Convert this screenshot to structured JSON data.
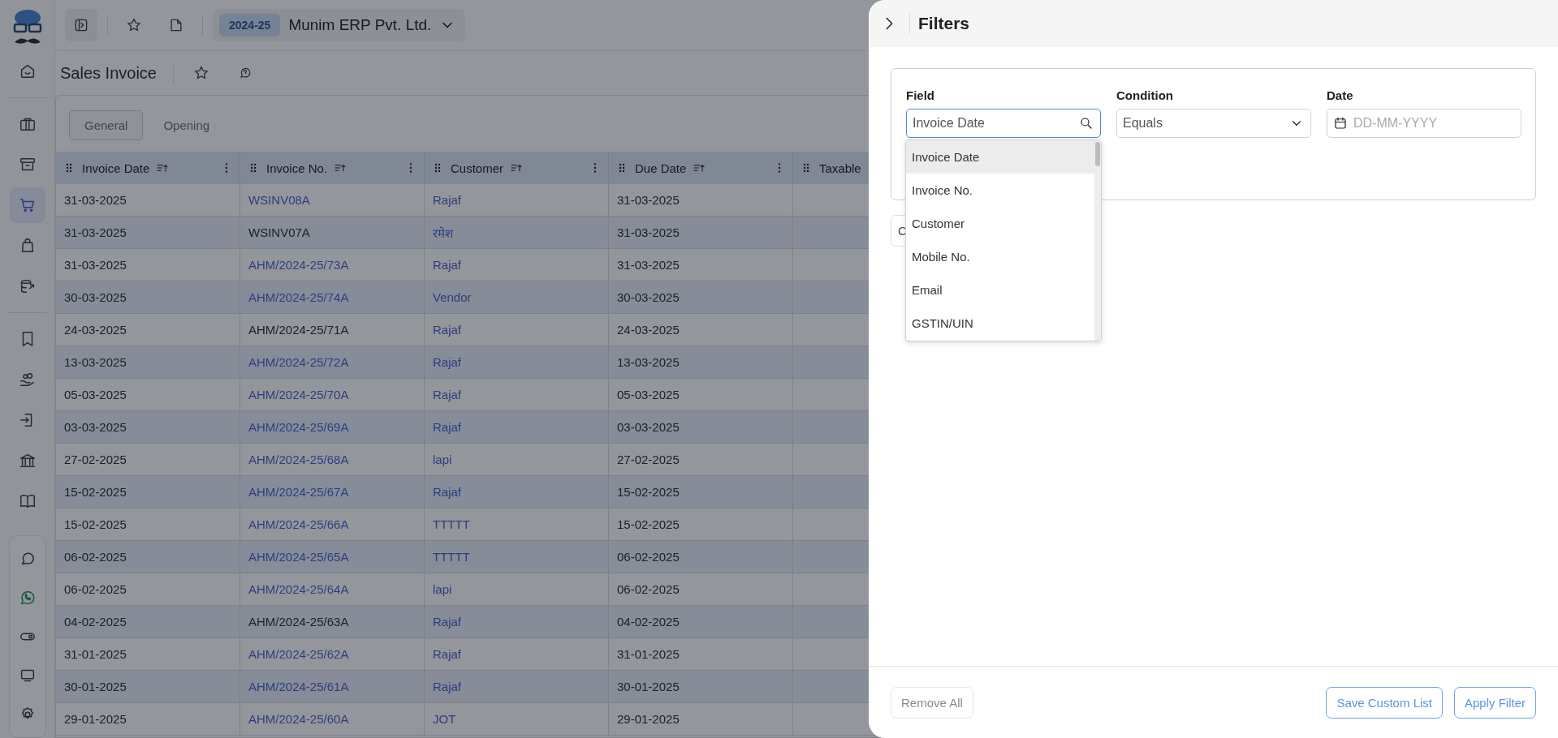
{
  "sidebar": {
    "items": [
      {
        "kind": "home",
        "selected": false
      },
      {
        "kind": "briefcase",
        "selected": false
      },
      {
        "kind": "archive",
        "selected": false
      },
      {
        "kind": "cart",
        "selected": true
      },
      {
        "kind": "bag",
        "selected": false
      },
      {
        "kind": "database",
        "selected": false
      },
      {
        "kind": "receipt",
        "selected": false
      },
      {
        "kind": "coins",
        "selected": false
      },
      {
        "kind": "login",
        "selected": false
      },
      {
        "kind": "bank",
        "selected": false
      },
      {
        "kind": "book",
        "selected": false
      }
    ],
    "bottom_items": [
      {
        "kind": "chat"
      },
      {
        "kind": "whatsapp"
      },
      {
        "kind": "toggle"
      },
      {
        "kind": "monitor"
      },
      {
        "kind": "gear"
      }
    ]
  },
  "top_bar": {
    "year": "2024-25",
    "company": "Munim ERP Pvt. Ltd."
  },
  "page": {
    "title": "Sales Invoice"
  },
  "tabs": [
    {
      "label": "General",
      "selected": true
    },
    {
      "label": "Opening",
      "selected": false
    }
  ],
  "table": {
    "columns": [
      "Invoice Date",
      "Invoice No.",
      "Customer",
      "Due Date",
      "Taxable"
    ],
    "rows": [
      {
        "cells": [
          {
            "text": "31-03-2025",
            "link": false
          },
          {
            "text": "WSINV08A",
            "link": true
          },
          {
            "text": "Rajaf",
            "link": true
          },
          {
            "text": "31-03-2025",
            "link": false
          }
        ]
      },
      {
        "cells": [
          {
            "text": "31-03-2025",
            "link": false
          },
          {
            "text": "WSINV07A",
            "link": false
          },
          {
            "text": "रमेश",
            "link": true
          },
          {
            "text": "31-03-2025",
            "link": false
          }
        ]
      },
      {
        "cells": [
          {
            "text": "31-03-2025",
            "link": false
          },
          {
            "text": "AHM/2024-25/73A",
            "link": true
          },
          {
            "text": "Rajaf",
            "link": true
          },
          {
            "text": "31-03-2025",
            "link": false
          }
        ]
      },
      {
        "cells": [
          {
            "text": "30-03-2025",
            "link": false
          },
          {
            "text": "AHM/2024-25/74A",
            "link": true
          },
          {
            "text": "Vendor",
            "link": true
          },
          {
            "text": "30-03-2025",
            "link": false
          }
        ]
      },
      {
        "cells": [
          {
            "text": "24-03-2025",
            "link": false
          },
          {
            "text": "AHM/2024-25/71A",
            "link": false
          },
          {
            "text": "Rajaf",
            "link": true
          },
          {
            "text": "24-03-2025",
            "link": false
          }
        ]
      },
      {
        "cells": [
          {
            "text": "13-03-2025",
            "link": false
          },
          {
            "text": "AHM/2024-25/72A",
            "link": true
          },
          {
            "text": "Rajaf",
            "link": true
          },
          {
            "text": "13-03-2025",
            "link": false
          }
        ]
      },
      {
        "cells": [
          {
            "text": "05-03-2025",
            "link": false
          },
          {
            "text": "AHM/2024-25/70A",
            "link": true
          },
          {
            "text": "Rajaf",
            "link": true
          },
          {
            "text": "05-03-2025",
            "link": false
          }
        ]
      },
      {
        "cells": [
          {
            "text": "03-03-2025",
            "link": false
          },
          {
            "text": "AHM/2024-25/69A",
            "link": true
          },
          {
            "text": "Rajaf",
            "link": true
          },
          {
            "text": "03-03-2025",
            "link": false
          }
        ]
      },
      {
        "cells": [
          {
            "text": "27-02-2025",
            "link": false
          },
          {
            "text": "AHM/2024-25/68A",
            "link": true
          },
          {
            "text": "lapi",
            "link": true
          },
          {
            "text": "27-02-2025",
            "link": false
          }
        ]
      },
      {
        "cells": [
          {
            "text": "15-02-2025",
            "link": false
          },
          {
            "text": "AHM/2024-25/67A",
            "link": true
          },
          {
            "text": "Rajaf",
            "link": true
          },
          {
            "text": "15-02-2025",
            "link": false
          }
        ]
      },
      {
        "cells": [
          {
            "text": "15-02-2025",
            "link": false
          },
          {
            "text": "AHM/2024-25/66A",
            "link": true
          },
          {
            "text": "TTTTT",
            "link": true
          },
          {
            "text": "15-02-2025",
            "link": false
          }
        ]
      },
      {
        "cells": [
          {
            "text": "06-02-2025",
            "link": false
          },
          {
            "text": "AHM/2024-25/65A",
            "link": true
          },
          {
            "text": "TTTTT",
            "link": true
          },
          {
            "text": "06-02-2025",
            "link": false
          }
        ]
      },
      {
        "cells": [
          {
            "text": "06-02-2025",
            "link": false
          },
          {
            "text": "AHM/2024-25/64A",
            "link": true
          },
          {
            "text": "lapi",
            "link": true
          },
          {
            "text": "06-02-2025",
            "link": false
          }
        ]
      },
      {
        "cells": [
          {
            "text": "04-02-2025",
            "link": false
          },
          {
            "text": "AHM/2024-25/63A",
            "link": false
          },
          {
            "text": "Rajaf",
            "link": true
          },
          {
            "text": "04-02-2025",
            "link": false
          }
        ]
      },
      {
        "cells": [
          {
            "text": "31-01-2025",
            "link": false
          },
          {
            "text": "AHM/2024-25/62A",
            "link": true
          },
          {
            "text": "Rajaf",
            "link": true
          },
          {
            "text": "31-01-2025",
            "link": false
          }
        ]
      },
      {
        "cells": [
          {
            "text": "30-01-2025",
            "link": false
          },
          {
            "text": "AHM/2024-25/61A",
            "link": true
          },
          {
            "text": "Rajaf",
            "link": true
          },
          {
            "text": "30-01-2025",
            "link": false
          }
        ]
      },
      {
        "cells": [
          {
            "text": "29-01-2025",
            "link": false
          },
          {
            "text": "AHM/2024-25/60A",
            "link": true
          },
          {
            "text": "JOT",
            "link": true
          },
          {
            "text": "29-01-2025",
            "link": false
          }
        ]
      }
    ]
  },
  "filters": {
    "title": "Filters",
    "field": {
      "label": "Field",
      "value": "Invoice Date"
    },
    "condition": {
      "label": "Condition",
      "value": "Equals"
    },
    "date": {
      "label": "Date",
      "placeholder": "DD-MM-YYYY"
    },
    "field_options": [
      {
        "label": "Invoice Date",
        "selected": true
      },
      {
        "label": "Invoice No.",
        "selected": false
      },
      {
        "label": "Customer",
        "selected": false
      },
      {
        "label": "Mobile No.",
        "selected": false
      },
      {
        "label": "Email",
        "selected": false
      },
      {
        "label": "GSTIN/UIN",
        "selected": false
      }
    ],
    "hidden_button": "C",
    "buttons": [
      {
        "label": "Remove All",
        "kind": "secondary",
        "disabled": true
      },
      {
        "label": "Save Custom List",
        "kind": "outline",
        "disabled": false
      },
      {
        "label": "Apply Filter",
        "kind": "outline",
        "disabled": false
      }
    ]
  }
}
